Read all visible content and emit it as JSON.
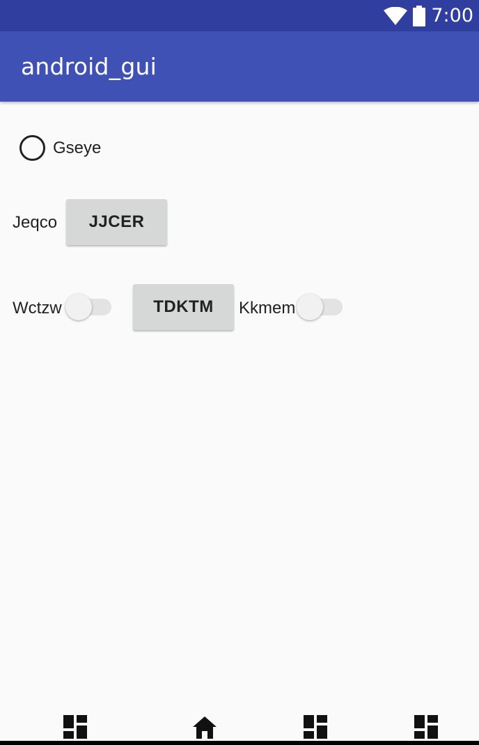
{
  "status_bar": {
    "time": "7:00",
    "wifi_icon": "wifi-icon",
    "battery_icon": "battery-icon"
  },
  "app_bar": {
    "title": "android_gui"
  },
  "radio": {
    "label": "Gseye",
    "checked": false
  },
  "row1": {
    "label": "Jeqco",
    "button_label": "JJCER"
  },
  "row2": {
    "label1": "Wctzw",
    "switch1_on": false,
    "button_label": "TDKTM",
    "label2": "Kkmem",
    "switch2_on": false
  },
  "nav_bar": {
    "icons": [
      "dashboard-icon",
      "home-icon",
      "dashboard-icon",
      "dashboard-icon"
    ]
  }
}
